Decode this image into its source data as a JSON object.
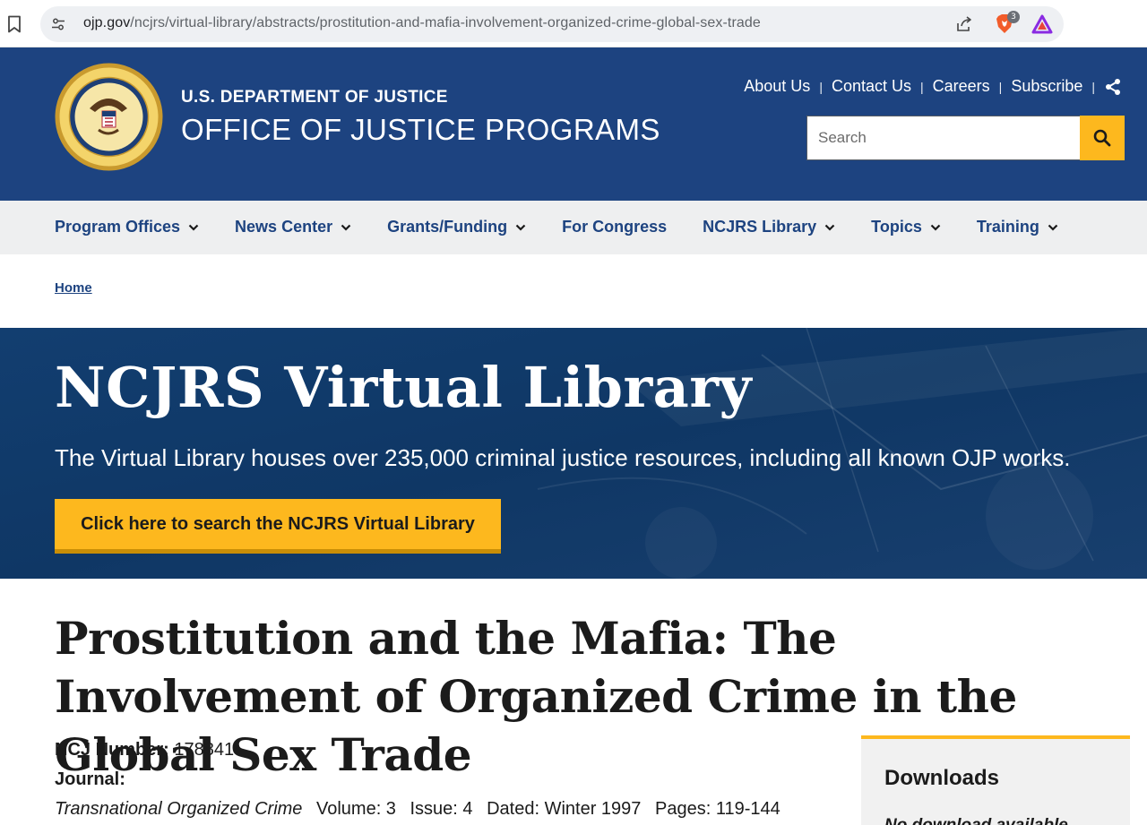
{
  "browser": {
    "url_host": "ojp.gov",
    "url_path": "/ncjrs/virtual-library/abstracts/prostitution-and-mafia-involvement-organized-crime-global-sex-trade",
    "brave_badge": "3"
  },
  "header": {
    "dept_name": "U.S. DEPARTMENT OF JUSTICE",
    "office_name": "OFFICE OF JUSTICE PROGRAMS",
    "utility_links": [
      "About Us",
      "Contact Us",
      "Careers",
      "Subscribe"
    ],
    "separator": "|",
    "search_placeholder": "Search"
  },
  "main_nav": [
    {
      "label": "Program Offices",
      "has_dropdown": true
    },
    {
      "label": "News Center",
      "has_dropdown": true
    },
    {
      "label": "Grants/Funding",
      "has_dropdown": true
    },
    {
      "label": "For Congress",
      "has_dropdown": false
    },
    {
      "label": "NCJRS Library",
      "has_dropdown": true
    },
    {
      "label": "Topics",
      "has_dropdown": true
    },
    {
      "label": "Training",
      "has_dropdown": true
    }
  ],
  "breadcrumb": {
    "home": "Home"
  },
  "hero": {
    "title": "NCJRS Virtual Library",
    "subtitle": "The Virtual Library houses over 235,000 criminal justice resources, including all known OJP works.",
    "button_label": "Click here to search the NCJRS Virtual Library"
  },
  "article": {
    "title": "Prostitution and the Mafia: The Involvement of Organized Crime in the Global Sex Trade",
    "ncj_label": "NCJ Number:",
    "ncj_value": "178841",
    "journal_label": "Journal:",
    "journal_name": "Transnational Organized Crime",
    "volume": "Volume: 3",
    "issue": "Issue: 4",
    "dated": "Dated: Winter 1997",
    "pages": "Pages: 119-144"
  },
  "downloads": {
    "title": "Downloads",
    "none_text": "No download available"
  },
  "colors": {
    "header_blue": "#1d4380",
    "accent_gold": "#fdb81e",
    "nav_gray": "#eeeff0",
    "hero_navy": "#0f3765"
  }
}
